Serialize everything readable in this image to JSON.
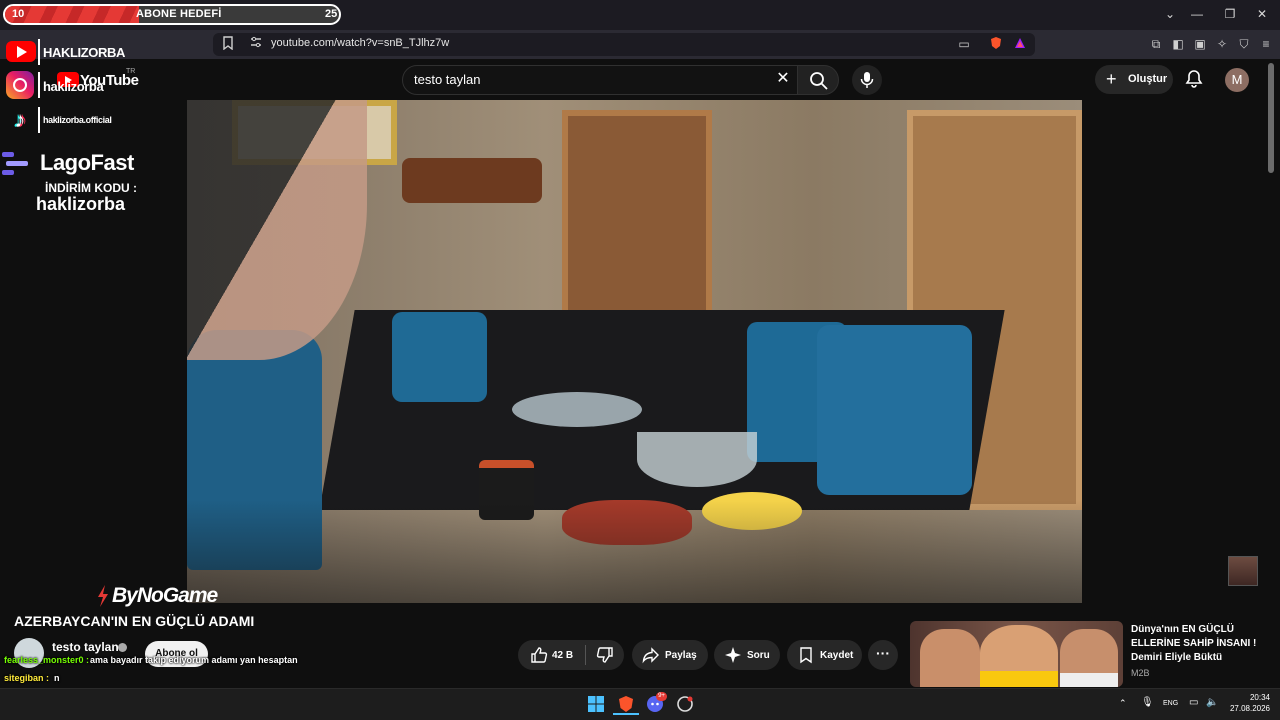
{
  "browser": {
    "url": "youtube.com/watch?v=snB_TJlhz7w"
  },
  "overlay": {
    "goal": {
      "current": "10",
      "label": "ABONE HEDEFİ",
      "target": "25",
      "progress_fraction": 0.4
    },
    "socials": [
      {
        "platform": "youtube-icon",
        "handle": "HAKLIZORBA"
      },
      {
        "platform": "instagram-icon",
        "handle": "haklizorba"
      },
      {
        "platform": "tiktok-icon",
        "handle": "haklizorba.official"
      }
    ],
    "sponsor": {
      "name": "LagoFast",
      "code_label": "İNDİRİM KODU :",
      "code": "haklizorba"
    },
    "video_sponsor": "ByNoGame"
  },
  "youtube": {
    "logo_text": "YouTube",
    "logo_region": "TR",
    "search_value": "testo taylan",
    "create_label": "Oluştur",
    "avatar_letter": "M"
  },
  "video": {
    "title": "AZERBAYCAN'IN EN GÜÇLÜ ADAMI",
    "channel": "testo taylan",
    "subscribe_label": "Abone ol",
    "likes": "42 B",
    "share_label": "Paylaş",
    "ask_label": "Soru",
    "save_label": "Kaydet"
  },
  "chat": [
    {
      "user": "fearless_monster0 :",
      "message": "ama bayadır takip ediyorum adamı yan hesaptan"
    },
    {
      "user": "sitegiban :",
      "message": "n"
    }
  ],
  "suggestion": {
    "title": "Dünya'nın EN GÜÇLÜ ELLERİNE SAHİP İNSANI ! Demiri Eliyle Büktü",
    "channel": "M2B"
  },
  "taskbar": {
    "language": "ENG",
    "time": "20:34",
    "date": "27.08.2026",
    "notification_badge": "9+"
  }
}
